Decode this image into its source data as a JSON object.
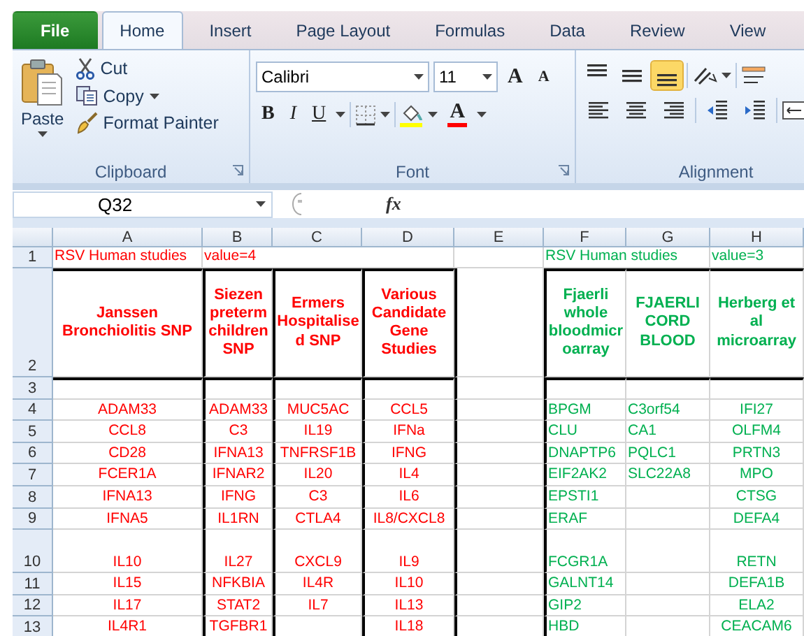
{
  "tabs": [
    {
      "label": "File",
      "kind": "file",
      "selected": false
    },
    {
      "label": "Home",
      "kind": "tab",
      "selected": true
    },
    {
      "label": "Insert",
      "kind": "tab",
      "selected": false
    },
    {
      "label": "Page Layout",
      "kind": "tab",
      "selected": false
    },
    {
      "label": "Formulas",
      "kind": "tab",
      "selected": false
    },
    {
      "label": "Data",
      "kind": "tab",
      "selected": false
    },
    {
      "label": "Review",
      "kind": "tab",
      "selected": false
    },
    {
      "label": "View",
      "kind": "tab",
      "selected": false
    }
  ],
  "ribbon": {
    "clipboard": {
      "label": "Clipboard",
      "paste": "Paste",
      "cut": "Cut",
      "copy": "Copy",
      "format_painter": "Format Painter"
    },
    "font": {
      "label": "Font",
      "font_name": "Calibri",
      "font_size": "11",
      "grow": "A",
      "shrink": "A",
      "bold": "B",
      "italic": "I",
      "underline": "U",
      "font_color": "A"
    },
    "alignment": {
      "label": "Alignment",
      "vertical": [
        {
          "kind": "top",
          "selected": false
        },
        {
          "kind": "middle",
          "selected": false
        },
        {
          "kind": "bottom",
          "selected": true
        }
      ]
    }
  },
  "formula_bar": {
    "name_box": "Q32",
    "fx": "fx"
  },
  "sheet": {
    "columns": [
      {
        "letter": "A",
        "color": "#ff0000"
      },
      {
        "letter": "B",
        "color": "#ff0000"
      },
      {
        "letter": "C",
        "color": "#ff0000"
      },
      {
        "letter": "D",
        "color": "#ff0000"
      },
      {
        "letter": "E"
      },
      {
        "letter": "F",
        "color": "#00b050"
      },
      {
        "letter": "G",
        "color": "#00b050"
      },
      {
        "letter": "H",
        "color": "#00b050"
      }
    ],
    "rows": [
      {
        "number": "1",
        "kind": "title",
        "cells": [
          "RSV Human studies",
          "value=4",
          "",
          "",
          "",
          "RSV Human studies",
          "",
          "value=3"
        ]
      },
      {
        "number": "2",
        "kind": "header",
        "cells": [
          "Janssen Bronchiolitis SNP",
          "Siezen preterm children SNP",
          "Ermers Hospitalised SNP",
          "Various Candidate Gene Studies",
          "",
          "Fjaerli whole bloodmicroarray",
          "FJAERLI CORD BLOOD",
          "Herberg et al microarray"
        ]
      },
      {
        "number": "3",
        "kind": "normal",
        "cells": [
          "",
          "",
          "",
          "",
          "",
          "",
          "",
          ""
        ]
      },
      {
        "number": "4",
        "kind": "normal",
        "cells": [
          "ADAM33",
          "ADAM33",
          "MUC5AC",
          "CCL5",
          "",
          "BPGM",
          "C3orf54",
          "IFI27"
        ]
      },
      {
        "number": "5",
        "kind": "normal",
        "cells": [
          "CCL8",
          "C3",
          "IL19",
          "IFNa",
          "",
          "CLU",
          "CA1",
          "OLFM4"
        ]
      },
      {
        "number": "6",
        "kind": "normal",
        "cells": [
          "CD28",
          "IFNA13",
          "TNFRSF1B",
          "IFNG",
          "",
          "DNAPTP6",
          "PQLC1",
          "PRTN3"
        ]
      },
      {
        "number": "7",
        "kind": "normal",
        "cells": [
          "FCER1A",
          "IFNAR2",
          "IL20",
          "IL4",
          "",
          "EIF2AK2",
          "SLC22A8",
          "MPO"
        ]
      },
      {
        "number": "8",
        "kind": "normal",
        "cells": [
          "IFNA13",
          "IFNG",
          "C3",
          "IL6",
          "",
          "EPSTI1",
          "",
          "CTSG"
        ]
      },
      {
        "number": "9",
        "kind": "normal",
        "cells": [
          "IFNA5",
          "IL1RN",
          "CTLA4",
          "IL8/CXCL8",
          "",
          "ERAF",
          "",
          "DEFA4"
        ]
      },
      {
        "number": "10",
        "kind": "tall",
        "cells": [
          "IL10",
          "IL27",
          "CXCL9",
          "IL9",
          "",
          "FCGR1A",
          "",
          "RETN"
        ]
      },
      {
        "number": "11",
        "kind": "normal",
        "cells": [
          "IL15",
          "NFKBIA",
          "IL4R",
          "IL10",
          "",
          "GALNT14",
          "",
          "DEFA1B"
        ]
      },
      {
        "number": "12",
        "kind": "normal",
        "cells": [
          "IL17",
          "STAT2",
          "IL7",
          "IL13",
          "",
          "GIP2",
          "",
          "ELA2"
        ]
      },
      {
        "number": "13",
        "kind": "normal",
        "cells": [
          "IL4R1",
          "TGFBR1",
          "",
          "IL18",
          "",
          "HBD",
          "",
          "CEACAM6"
        ]
      }
    ]
  }
}
